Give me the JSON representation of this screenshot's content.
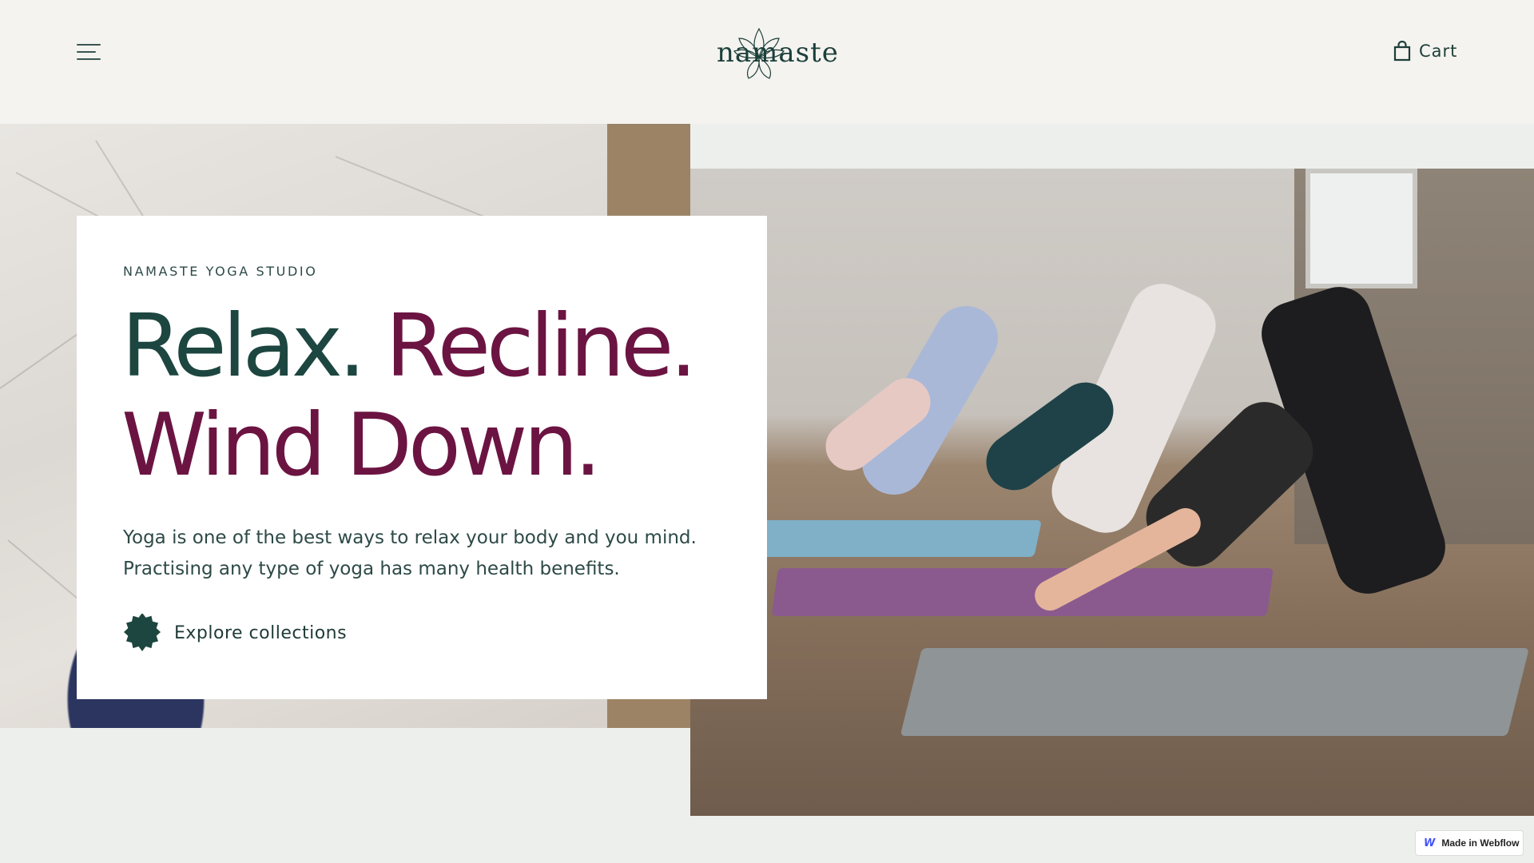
{
  "header": {
    "menu_icon": "hamburger-menu-icon",
    "logo_text": "namaste",
    "logo_icon": "lotus-icon",
    "cart_icon": "shopping-bag-icon",
    "cart_label": "Cart"
  },
  "hero": {
    "eyebrow": "NAMASTE YOGA STUDIO",
    "headline_part1": "Relax.",
    "headline_part2": "Recline.",
    "headline_part3": "Wind Down.",
    "description_line1": "Yoga is one of the best ways to relax your body and you mind.",
    "description_line2": "Practising any type of yoga has many health benefits.",
    "cta_icon": "star-badge-icon",
    "cta_label": "Explore collections"
  },
  "badge": {
    "icon": "webflow-icon",
    "icon_glyph": "W",
    "label": "Made in Webflow"
  },
  "colors": {
    "header_bg": "#f4f3ef",
    "page_bg": "#ecefec",
    "primary_green": "#1d4640",
    "accent_plum": "#6b1442"
  }
}
